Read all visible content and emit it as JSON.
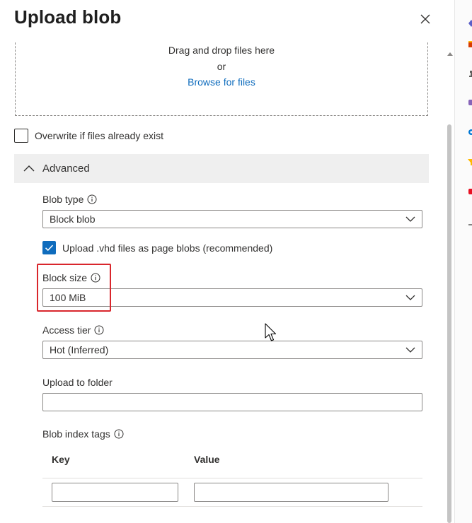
{
  "panel": {
    "title": "Upload blob"
  },
  "dropzone": {
    "drag_text": "Drag and drop files here",
    "or_text": "or",
    "browse_label": "Browse for files"
  },
  "overwrite": {
    "label": "Overwrite if files already exist",
    "checked": false
  },
  "advanced": {
    "label": "Advanced",
    "expanded": true
  },
  "blob_type": {
    "label": "Blob type",
    "value": "Block blob"
  },
  "vhd_upload": {
    "label": "Upload .vhd files as page blobs (recommended)",
    "checked": true
  },
  "block_size": {
    "label": "Block size",
    "value": "100 MiB"
  },
  "access_tier": {
    "label": "Access tier",
    "value": "Hot (Inferred)"
  },
  "upload_folder": {
    "label": "Upload to folder",
    "value": ""
  },
  "index_tags": {
    "label": "Blob index tags",
    "key_header": "Key",
    "value_header": "Value",
    "rows": [
      {
        "key": "",
        "value": ""
      }
    ]
  },
  "colors": {
    "accent": "#0f6cbd",
    "highlight": "#d9262c",
    "section_bg": "#efefef",
    "border": "#8a8886"
  }
}
